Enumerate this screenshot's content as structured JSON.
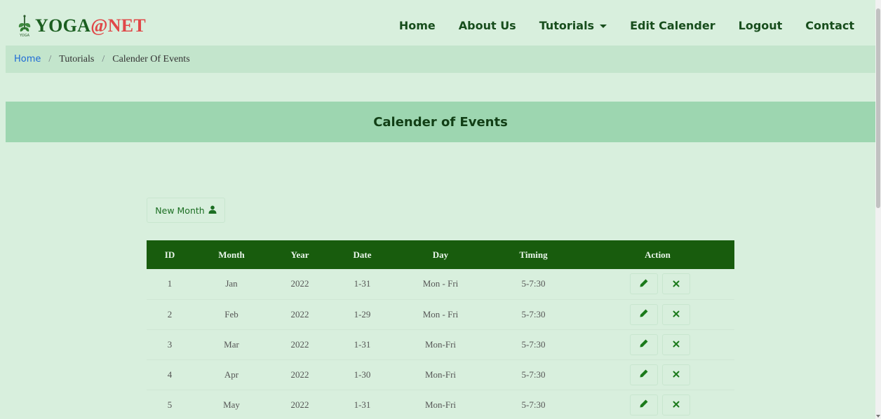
{
  "brand": {
    "yoga": "YOGA",
    "at": "@",
    "net": "NET",
    "icon": "yoga-leaf-icon"
  },
  "nav": {
    "home": "Home",
    "about": "About Us",
    "tutorials": "Tutorials",
    "edit_calender": "Edit Calender",
    "logout": "Logout",
    "contact": "Contact"
  },
  "breadcrumb": {
    "home": "Home",
    "sep": "/",
    "tutorials": "Tutorials",
    "current": "Calender Of Events"
  },
  "heading": "Calender of Events",
  "new_month_button": {
    "label": "New Month",
    "icon": "user-icon"
  },
  "table": {
    "headers": {
      "id": "ID",
      "month": "Month",
      "year": "Year",
      "date": "Date",
      "day": "Day",
      "timing": "Timing",
      "action": "Action"
    },
    "rows": [
      {
        "id": "1",
        "month": "Jan",
        "year": "2022",
        "date": "1-31",
        "day": "Mon - Fri",
        "timing": "5-7:30"
      },
      {
        "id": "2",
        "month": "Feb",
        "year": "2022",
        "date": "1-29",
        "day": "Mon - Fri",
        "timing": "5-7:30"
      },
      {
        "id": "3",
        "month": "Mar",
        "year": "2022",
        "date": "1-31",
        "day": "Mon-Fri",
        "timing": "5-7:30"
      },
      {
        "id": "4",
        "month": "Apr",
        "year": "2022",
        "date": "1-30",
        "day": "Mon-Fri",
        "timing": "5-7:30"
      },
      {
        "id": "5",
        "month": "May",
        "year": "2022",
        "date": "1-31",
        "day": "Mon-Fri",
        "timing": "5-7:30"
      }
    ]
  },
  "colors": {
    "nav_bg": "#d8efdd",
    "breadcrumb_bg": "#c3e5cc",
    "heading_bg": "#9dd6b0",
    "table_header_bg": "#185c0d",
    "accent": "#1b6e22",
    "brand_red": "#e04848"
  }
}
